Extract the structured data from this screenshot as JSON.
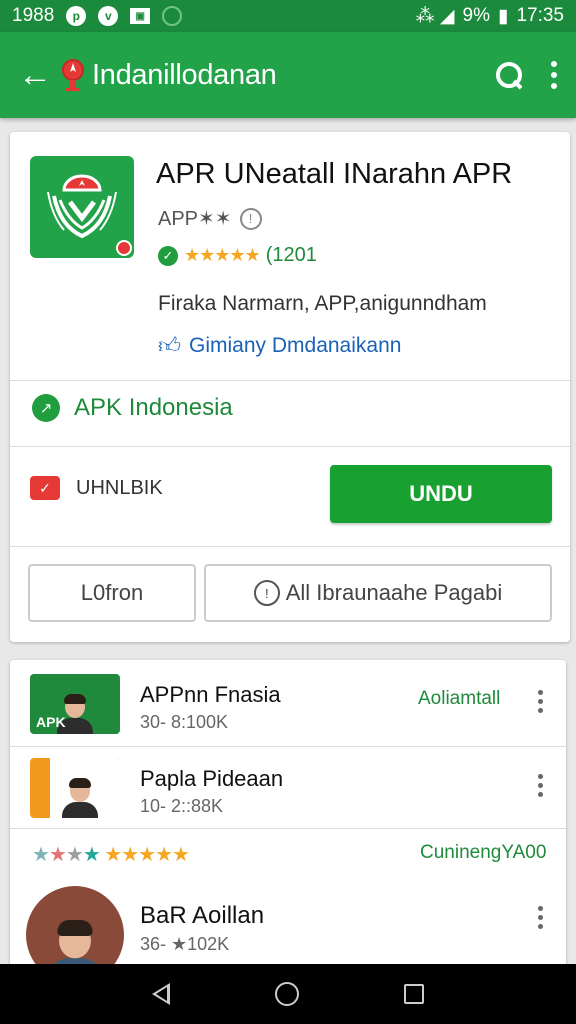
{
  "status_bar": {
    "time_left": "1988",
    "icons_left": [
      "p-icon",
      "shield-icon",
      "image-icon",
      "circle-icon"
    ],
    "battery": "9%",
    "time": "17:35"
  },
  "app_bar": {
    "title": "Indanillodanan"
  },
  "app": {
    "title": "APR UNeatall INarahn APR",
    "subtitle": "APP✶✶",
    "rating_count": "(1201",
    "description": "Firaka Narmarn, APP,anigunndham",
    "developer": "Gimiany Dmdanaikann",
    "source": "APK Indonesia",
    "download_label": "UHNLBIK",
    "install_label": "UNDU",
    "button_left": "L0fron",
    "button_right": "All Ibraunaahe Pagabi"
  },
  "list": [
    {
      "name": "APPnn Fnasia",
      "meta": "30- 8:100K",
      "status": "Aoliamtall"
    },
    {
      "name": "Papla Pideaan",
      "meta": "10- 2::88K",
      "status": ""
    },
    {
      "name": "BaR Aoillan",
      "meta": "36- ★102K",
      "status": ""
    }
  ],
  "rating_line": {
    "status": "CuninengYA00"
  },
  "colors": {
    "primary": "#22a34a",
    "primary_dark": "#1b8a3c",
    "install": "#18a130",
    "link": "#1a62b8"
  }
}
